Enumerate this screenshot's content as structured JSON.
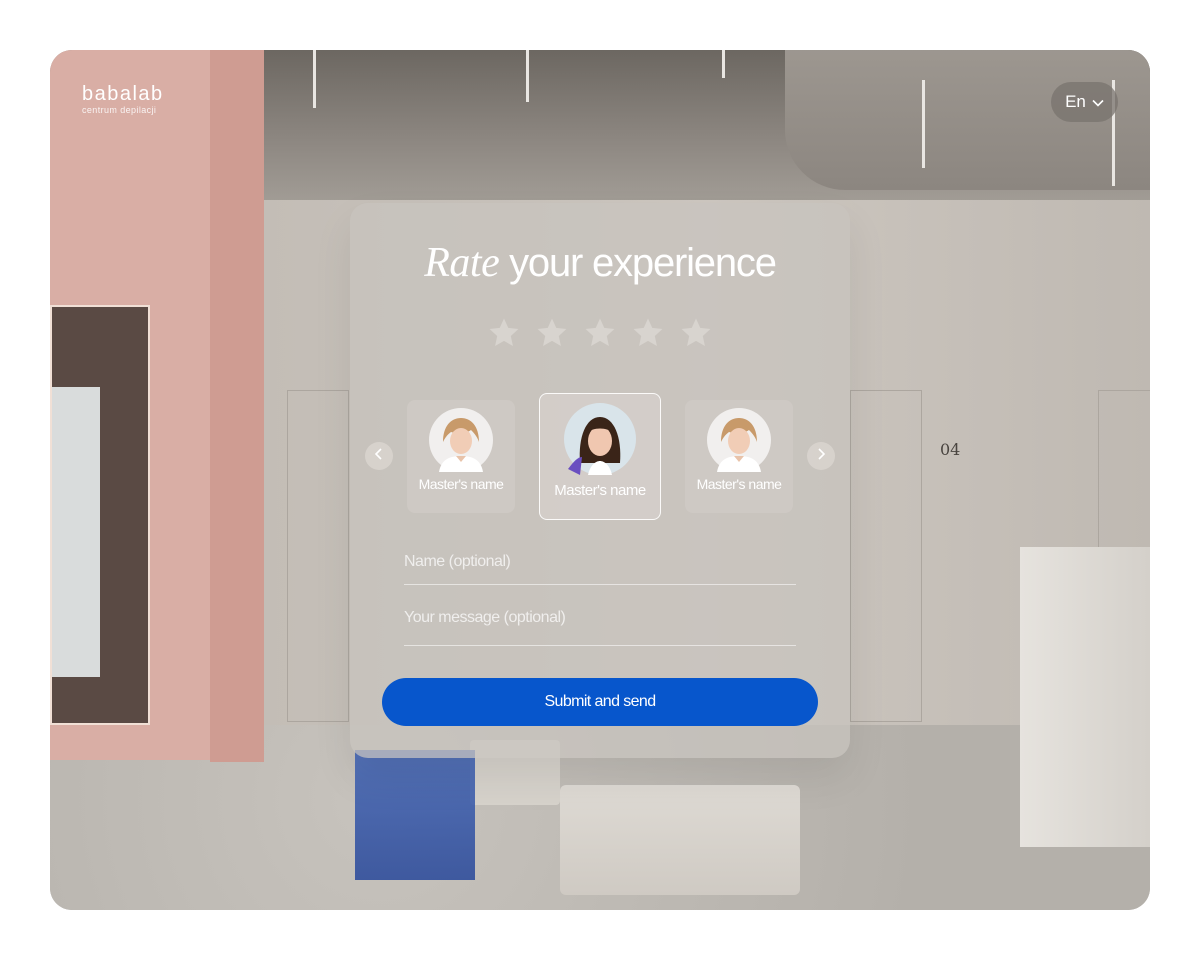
{
  "brand": {
    "name": "babalab",
    "subtitle": "centrum depilacji"
  },
  "language": {
    "current": "En",
    "icon": "chevron-down-icon"
  },
  "room_number": "04",
  "card": {
    "title_emphasis": "Rate",
    "title_rest": " your experience",
    "rating": {
      "value": 0,
      "max": 5,
      "icon": "star-icon",
      "empty_color": "#d8d4cf"
    },
    "carousel": {
      "prev_icon": "chevron-left-icon",
      "next_icon": "chevron-right-icon",
      "masters": [
        {
          "name": "Master's name",
          "selected": false
        },
        {
          "name": "Master's name",
          "selected": true
        },
        {
          "name": "Master's name",
          "selected": false
        }
      ]
    },
    "form": {
      "name_placeholder": "Name (optional)",
      "name_value": "",
      "message_placeholder": "Your message (optional)",
      "message_value": "",
      "submit_label": "Submit and send"
    }
  },
  "colors": {
    "accent": "#0756cc",
    "text_on_glass": "#ffffff"
  }
}
